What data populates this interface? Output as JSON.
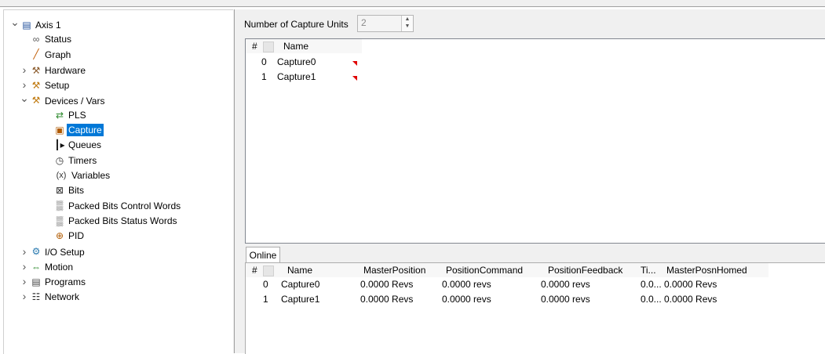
{
  "tree": [
    {
      "label": "Axis 1",
      "arrow": "expanded",
      "icon": "axis-icon",
      "glyph": "▤",
      "selected": false,
      "level": 0
    },
    {
      "label": "Status",
      "arrow": "none",
      "icon": "status-icon",
      "glyph": "∞",
      "selected": false,
      "level": 1
    },
    {
      "label": "Graph",
      "arrow": "none",
      "icon": "graph-icon",
      "glyph": "╱",
      "selected": false,
      "level": 1
    },
    {
      "label": "Hardware",
      "arrow": "collapsed",
      "icon": "hammer-icon",
      "glyph": "⚒",
      "selected": false,
      "level": 1
    },
    {
      "label": "Setup",
      "arrow": "collapsed",
      "icon": "tools-icon",
      "glyph": "⚒",
      "selected": false,
      "level": 1
    },
    {
      "label": "Devices / Vars",
      "arrow": "expanded",
      "icon": "tools-icon",
      "glyph": "⚒",
      "selected": false,
      "level": 1
    },
    {
      "label": "PLS",
      "arrow": "none",
      "icon": "pls-icon",
      "glyph": "⇄",
      "selected": false,
      "level": 2
    },
    {
      "label": "Capture",
      "arrow": "none",
      "icon": "camera-icon",
      "glyph": "▣",
      "selected": true,
      "level": 2
    },
    {
      "label": "Queues",
      "arrow": "none",
      "icon": "queue-icon",
      "glyph": "┃▸",
      "selected": false,
      "level": 2
    },
    {
      "label": "Timers",
      "arrow": "none",
      "icon": "timer-icon",
      "glyph": "◷",
      "selected": false,
      "level": 2
    },
    {
      "label": "Variables",
      "arrow": "none",
      "icon": "variable-icon",
      "glyph": "(x)",
      "selected": false,
      "level": 2
    },
    {
      "label": "Bits",
      "arrow": "none",
      "icon": "bits-icon",
      "glyph": "⊠",
      "selected": false,
      "level": 2
    },
    {
      "label": "Packed Bits Control Words",
      "arrow": "none",
      "icon": "packed-bits-icon",
      "glyph": "▒",
      "selected": false,
      "level": 2
    },
    {
      "label": "Packed Bits Status Words",
      "arrow": "none",
      "icon": "packed-bits-icon",
      "glyph": "▒",
      "selected": false,
      "level": 2
    },
    {
      "label": "PID",
      "arrow": "none",
      "icon": "pid-icon",
      "glyph": "⊕",
      "selected": false,
      "level": 2
    },
    {
      "label": "I/O Setup",
      "arrow": "collapsed",
      "icon": "io-icon",
      "glyph": "⚙",
      "selected": false,
      "level": 1
    },
    {
      "label": "Motion",
      "arrow": "collapsed",
      "icon": "motion-icon",
      "glyph": "⇔",
      "selected": false,
      "level": 1
    },
    {
      "label": "Programs",
      "arrow": "collapsed",
      "icon": "program-icon",
      "glyph": "▤",
      "selected": false,
      "level": 1
    },
    {
      "label": "Network",
      "arrow": "collapsed",
      "icon": "network-icon",
      "glyph": "☷",
      "selected": false,
      "level": 1
    }
  ],
  "capture_units": {
    "label": "Number of Capture Units",
    "value": "2"
  },
  "top_grid": {
    "headers": [
      "#",
      "Name"
    ],
    "rows": [
      [
        "0",
        "Capture0"
      ],
      [
        "1",
        "Capture1"
      ]
    ]
  },
  "online_tab": "Online",
  "bottom_grid": {
    "headers": [
      "#",
      "Name",
      "MasterPosition",
      "PositionCommand",
      "PositionFeedback",
      "Ti...",
      "MasterPosnHomed"
    ],
    "rows": [
      [
        "0",
        "Capture0",
        "0.0000 Revs",
        "0.0000 revs",
        "0.0000 revs",
        "0.0...",
        "0.0000 Revs"
      ],
      [
        "1",
        "Capture1",
        "0.0000 Revs",
        "0.0000 revs",
        "0.0000 revs",
        "0.0...",
        "0.0000 Revs"
      ]
    ]
  },
  "colors": {
    "selection": "#0078d7",
    "marker": "#e00000"
  }
}
